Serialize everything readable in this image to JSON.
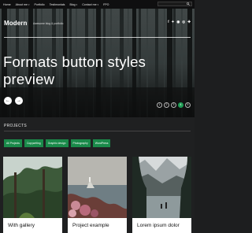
{
  "nav": {
    "items": [
      {
        "label": "Home",
        "has_caret": false
      },
      {
        "label": "About me",
        "has_caret": true
      },
      {
        "label": "Portfolio",
        "has_caret": false
      },
      {
        "label": "Testimonials",
        "has_caret": false
      },
      {
        "label": "Blog",
        "has_caret": true
      },
      {
        "label": "Contact me",
        "has_caret": true
      },
      {
        "label": "FPO",
        "has_caret": false
      }
    ],
    "search_icon": "search-icon"
  },
  "header": {
    "brand": "Modern",
    "tagline": "Awesome blog & portfolio",
    "social": [
      "f",
      "✦",
      "◉",
      "◎",
      "✚"
    ]
  },
  "hero": {
    "title": "Formats button styles preview",
    "prev_symbol": "←",
    "next_symbol": "→",
    "dots": [
      "1",
      "2",
      "3",
      "4",
      "5"
    ],
    "active_dot": 3
  },
  "projects": {
    "title": "PROJECTS",
    "filters": [
      "All Projects",
      "Copywriting",
      "Graphic design",
      "Photography",
      "WordPress"
    ],
    "cards": [
      {
        "label": "With gallery"
      },
      {
        "label": "Project example"
      },
      {
        "label": "Lorem ipsum dolor"
      }
    ]
  },
  "colors": {
    "accent": "#1a8a4a",
    "active_dot": "#1f9d55",
    "background": "#1f2021",
    "topbar": "#0f0f10"
  }
}
